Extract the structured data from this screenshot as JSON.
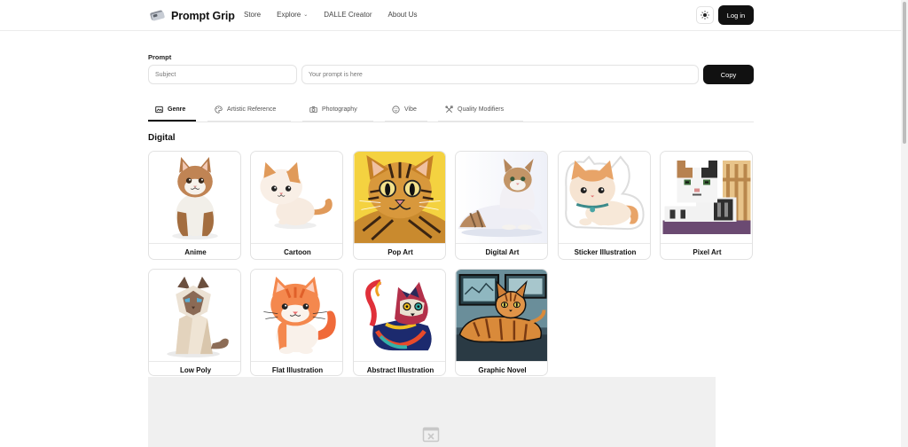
{
  "header": {
    "brand": "Prompt Grip",
    "nav": [
      {
        "label": "Store"
      },
      {
        "label": "Explore"
      },
      {
        "label": "DALLE Creator"
      },
      {
        "label": "About Us"
      }
    ],
    "login_label": "Log in"
  },
  "prompt": {
    "label": "Prompt",
    "subject_placeholder": "Subject",
    "prompt_placeholder": "Your prompt is here",
    "copy_label": "Copy"
  },
  "tabs": [
    {
      "label": "Genre",
      "icon": "palette-frame-icon",
      "active": true
    },
    {
      "label": "Artistic Reference",
      "icon": "palette-icon"
    },
    {
      "label": "Photography",
      "icon": "camera-icon"
    },
    {
      "label": "Vibe",
      "icon": "smile-icon"
    },
    {
      "label": "Quality Modifiers",
      "icon": "tools-icon"
    }
  ],
  "section": {
    "title": "Digital",
    "cards": [
      {
        "label": "Anime"
      },
      {
        "label": "Cartoon"
      },
      {
        "label": "Pop Art"
      },
      {
        "label": "Digital Art"
      },
      {
        "label": "Sticker Illustration"
      },
      {
        "label": "Pixel Art"
      },
      {
        "label": "Low Poly"
      },
      {
        "label": "Flat Illustration"
      },
      {
        "label": "Abstract Illustration"
      },
      {
        "label": "Graphic Novel"
      }
    ]
  },
  "colors": {
    "primary": "#111111",
    "border": "#e2e2e2",
    "ad_background": "#f0f0f0"
  }
}
